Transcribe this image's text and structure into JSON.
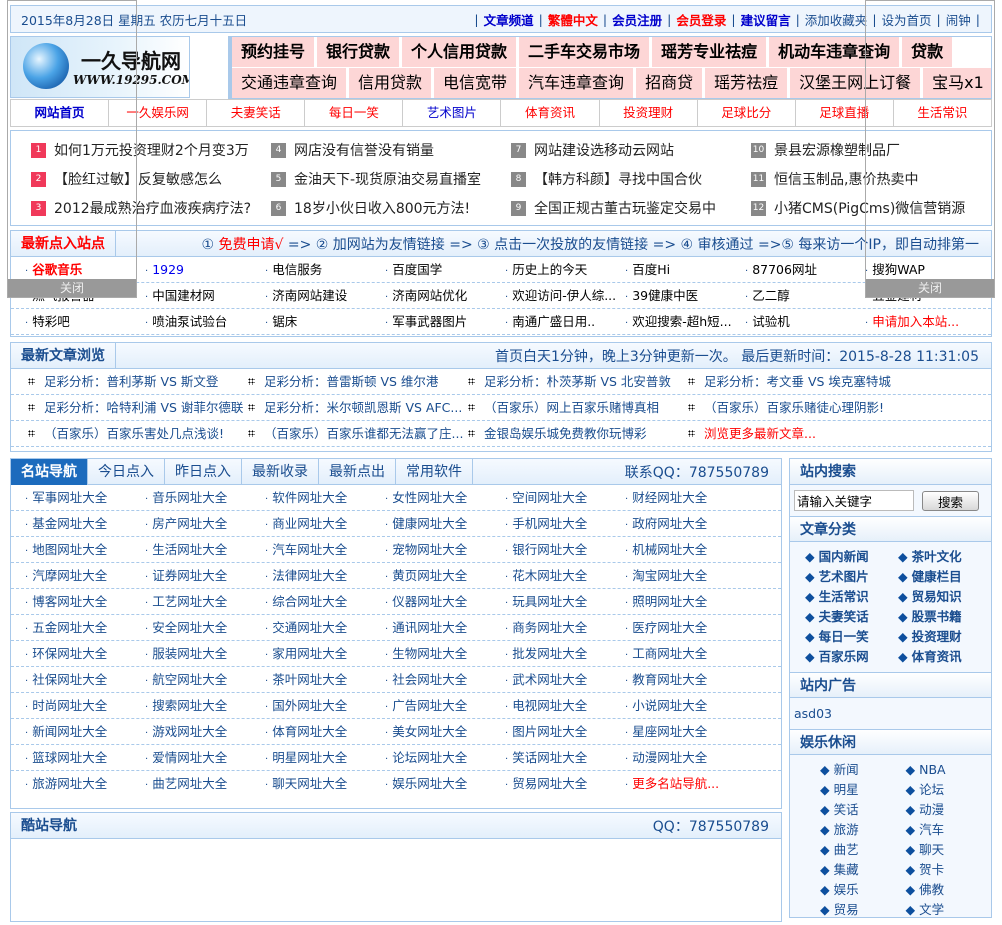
{
  "top": {
    "date": "2015年8月28日 星期五 农历七月十五日",
    "links": [
      {
        "t": "文章频道",
        "c": "#0000cc"
      },
      {
        "t": "繁體中文",
        "c": "#ff0000"
      },
      {
        "t": "会员注册",
        "c": "#0000cc"
      },
      {
        "t": "会员登录",
        "c": "#ff0000"
      },
      {
        "t": "建议留言",
        "c": "#0000cc"
      },
      {
        "t": "添加收藏夹",
        "c": "#1a4d8f",
        "n": 1
      },
      {
        "t": "设为首页",
        "c": "#1a4d8f",
        "n": 1
      },
      {
        "t": "闹钟",
        "c": "#1a4d8f",
        "n": 1
      }
    ]
  },
  "logo": {
    "name": "一久导航网",
    "url": "WWW.19295.COM"
  },
  "ads": {
    "row1": [
      "预约挂号",
      "银行贷款",
      "个人信用贷款",
      "二手车交易市场",
      "瑶芳专业祛痘",
      "机动车违章查询",
      "贷款"
    ],
    "row2": [
      "交通违章查询",
      "信用贷款",
      "电信宽带",
      "汽车违章查询",
      "招商贷",
      "瑶芳祛痘",
      "汉堡王网上订餐",
      "宝马x1"
    ]
  },
  "nav": [
    "网站首页",
    "一久娱乐网",
    "夫妻笑话",
    "每日一笑",
    "艺术图片",
    "体育资讯",
    "投资理财",
    "足球比分",
    "足球直播",
    "生活常识"
  ],
  "hot": [
    "如何1万元投资理财2个月变3万",
    "【脸红过敏】反复敏感怎么",
    "2012最成熟治疗血液疾病疗法?",
    "网店没有信誉没有销量",
    "金油天下-现货原油交易直播室",
    "18岁小伙日收入800元方法!",
    "网站建设选移动云网站",
    "【韩方科颜】寻找中国合伙",
    "全国正规古董古玩鉴定交易中",
    "景县宏源橡塑制品厂",
    "恒信玉制品,惠价热卖中",
    "小猪CMS(PigCms)微信营销源"
  ],
  "latest": {
    "title": "最新点入站点",
    "steps": "① 免费申请√ => ② 加网站为友情链接 => ③ 点击一次投放的友情链接 => ④ 审核通过 =>⑤ 每来访一个IP，即自动排第一",
    "step1": "① ",
    "step1b": "免费申请√",
    "step_rest": " => ② 加网站为友情链接  => ③ 点击一次投放的友情链接  => ④ 审核通过  =>⑤ 每来访一个IP，即自动排第一",
    "rows": [
      [
        "谷歌音乐",
        "1929",
        "电信服务",
        "百度国学",
        "历史上的今天",
        "百度Hi",
        "87706网址",
        "搜狗WAP"
      ],
      [
        "燃气报警器",
        "中国建材网",
        "济南网站建设",
        "济南网站优化",
        "欢迎访问-伊人综...",
        "39健康中医",
        "乙二醇",
        "五金建材"
      ],
      [
        "特彩吧",
        "喷油泵试验台",
        "锯床",
        "军事武器图片",
        "南通广盛日用..",
        "欢迎搜索-超h短...",
        "试验机",
        "申请加入本站..."
      ]
    ]
  },
  "articles": {
    "title": "最新文章浏览",
    "info": "首页白天1分钟，晚上3分钟更新一次。 最后更新时间：2015-8-28 11:31:05",
    "rows": [
      [
        "足彩分析：普利茅斯 VS 斯文登",
        "足彩分析：普雷斯顿 VS 维尔港",
        "足彩分析：朴茨茅斯 VS 北安普敦",
        "足彩分析：考文垂 VS 埃克塞特城"
      ],
      [
        "足彩分析：哈特利浦 VS 谢菲尔德联",
        "足彩分析：米尔顿凯恩斯 VS AFC...",
        "（百家乐）网上百家乐赌博真相",
        "（百家乐）百家乐赌徒心理阴影!"
      ],
      [
        "（百家乐）百家乐害处几点浅谈!",
        "（百家乐）百家乐谁都无法赢了庄...",
        "金银岛娱乐城免费教你玩博彩",
        "浏览更多最新文章..."
      ]
    ]
  },
  "tabs": [
    "名站导航",
    "今日点入",
    "昨日点入",
    "最新收录",
    "最新点出",
    "常用软件"
  ],
  "qq": "联系QQ：787550789",
  "suffix": "网址大全",
  "grid": [
    [
      "军事",
      "音乐",
      "软件",
      "女性",
      "空间",
      "财经"
    ],
    [
      "基金",
      "房产",
      "商业",
      "健康",
      "手机",
      "政府"
    ],
    [
      "地图",
      "生活",
      "汽车",
      "宠物",
      "银行",
      "机械"
    ],
    [
      "汽摩",
      "证券",
      "法律",
      "黄页",
      "花木",
      "淘宝"
    ],
    [
      "博客",
      "工艺",
      "综合",
      "仪器",
      "玩具",
      "照明"
    ],
    [
      "五金",
      "安全",
      "交通",
      "通讯",
      "商务",
      "医疗"
    ],
    [
      "环保",
      "服装",
      "家用",
      "生物",
      "批发",
      "工商"
    ],
    [
      "社保",
      "航空",
      "茶叶",
      "社会",
      "武术",
      "教育"
    ],
    [
      "时尚",
      "搜索",
      "国外",
      "广告",
      "电视",
      "小说"
    ],
    [
      "新闻",
      "游戏",
      "体育",
      "美女",
      "图片",
      "星座"
    ],
    [
      "篮球",
      "爱情",
      "明星",
      "论坛",
      "笑话",
      "动漫"
    ],
    [
      "旅游",
      "曲艺",
      "聊天",
      "娱乐",
      "贸易"
    ]
  ],
  "grid_more": "更多名站导航...",
  "kuzhan": {
    "title": "酷站导航",
    "qq": "QQ：787550789"
  },
  "sidebar": {
    "search_title": "站内搜索",
    "search_placeholder": "请输入关键字",
    "search_btn": "搜索",
    "cat_title": "文章分类",
    "cats": [
      "国内新闻",
      "茶叶文化",
      "艺术图片",
      "健康栏目",
      "生活常识",
      "贸易知识",
      "夫妻笑话",
      "股票书籍",
      "每日一笑",
      "投资理财",
      "百家乐网",
      "体育资讯"
    ],
    "ad_title": "站内广告",
    "ad_text": "asd03",
    "fun_title": "娱乐休闲",
    "fun": [
      "新闻",
      "NBA",
      "明星",
      "论坛",
      "笑话",
      "动漫",
      "旅游",
      "汽车",
      "曲艺",
      "聊天",
      "集藏",
      "贺卡",
      "娱乐",
      "佛教",
      "贸易",
      "文学"
    ]
  },
  "float": {
    "close": "关闭"
  },
  "colors": {
    "accent": "#1c6bbd",
    "border": "#a9c9ea",
    "red": "#ff0000",
    "pink": "#fdd6d6"
  }
}
